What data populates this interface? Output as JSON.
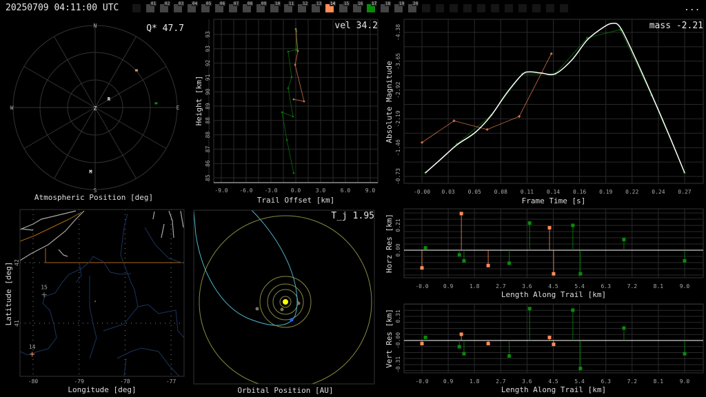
{
  "header": {
    "title": "20250709 04:11:00 UTC",
    "more_label": "..."
  },
  "frames": {
    "leading_empty": 1,
    "labels": [
      "01",
      "02",
      "03",
      "04",
      "05",
      "06",
      "07",
      "08",
      "09",
      "10",
      "11",
      "12",
      "13",
      "14",
      "15",
      "16",
      "17",
      "18",
      "19",
      "20"
    ],
    "trailing_empty": 11,
    "highlighted": {
      "14": "#ff8c5a",
      "17": "#0a8a0a"
    }
  },
  "colors": {
    "station_a": "#ff8c5a",
    "station_b": "#0a8a0a",
    "fit": "#ffffff",
    "grid": "#333333",
    "sun": "#ffff00",
    "orbit_planet": "#8a8a40",
    "orbit_meteor": "#4fb3c8",
    "earth": "#1a6cff"
  },
  "polar": {
    "title": "Atmospheric Position [deg]",
    "stat_label": "Q* 47.7",
    "compass": {
      "n": "N",
      "s": "S",
      "e": "E",
      "w": "W",
      "zenith": "Z"
    },
    "points": [
      {
        "az": 48,
        "zenith": 61,
        "color": "#ff8c5a"
      },
      {
        "az": 86,
        "zenith": 67,
        "color": "#0a8a0a"
      }
    ],
    "markers": [
      {
        "label": "R",
        "az": 57,
        "zenith": 18
      },
      {
        "label": "M",
        "az": 184,
        "zenith": 70
      }
    ]
  },
  "height_plot": {
    "stat_label": "vel 34.2",
    "xlabel": "Trail Offset [km]",
    "ylabel": "Height [km]",
    "xticks": [
      "-9.0",
      "-6.0",
      "-3.0",
      "0.0",
      "3.0",
      "6.0",
      "9.0"
    ],
    "yticks": [
      "85",
      "86",
      "87",
      "88",
      "88",
      "89",
      "90",
      "91",
      "92",
      "93",
      "93"
    ],
    "series": [
      {
        "color": "#0a8a0a",
        "points": [
          [
            0.08,
            93.6
          ],
          [
            0.08,
            92.51
          ],
          [
            -0.92,
            92.39
          ],
          [
            -0.5,
            90.9
          ],
          [
            -0.92,
            90.25
          ],
          [
            -0.33,
            88.59
          ],
          [
            -1.67,
            88.84
          ],
          [
            -1.08,
            87.22
          ],
          [
            -0.25,
            85.28
          ]
        ]
      },
      {
        "color": "#ff8c5a",
        "points": [
          [
            0.0,
            93.72
          ],
          [
            0.25,
            92.43
          ],
          [
            -0.08,
            91.62
          ],
          [
            1.0,
            89.48
          ],
          [
            -0.25,
            89.6
          ]
        ]
      }
    ]
  },
  "magnitude_plot": {
    "stat_label": "mass -2.21",
    "xlabel": "Frame Time [s]",
    "ylabel": "Absolute Magnitude",
    "xticks": [
      "-0.00",
      "0.03",
      "0.05",
      "0.08",
      "0.11",
      "0.14",
      "0.16",
      "0.19",
      "0.22",
      "0.24",
      "0.27"
    ],
    "yticks": [
      "-4.38",
      "-3.65",
      "-2.92",
      "-2.19",
      "-1.46",
      "-0.73"
    ],
    "series": [
      {
        "color": "#0a8a0a",
        "points": [
          [
            0.0035,
            -0.82
          ],
          [
            0.036,
            -1.55
          ],
          [
            0.071,
            -2.28
          ],
          [
            0.103,
            -3.33
          ],
          [
            0.137,
            -3.33
          ],
          [
            0.17,
            -4.24
          ],
          [
            0.204,
            -4.45
          ],
          [
            0.236,
            -2.79
          ],
          [
            0.27,
            -0.82
          ]
        ]
      },
      {
        "color": "#ff8c5a",
        "points": [
          [
            0.0,
            -1.59
          ],
          [
            0.033,
            -2.14
          ],
          [
            0.067,
            -1.92
          ],
          [
            0.1,
            -2.25
          ],
          [
            0.133,
            -3.84
          ]
        ]
      }
    ],
    "fit": [
      [
        0.0035,
        -0.82
      ],
      [
        0.02,
        -1.18
      ],
      [
        0.036,
        -1.53
      ],
      [
        0.055,
        -1.85
      ],
      [
        0.071,
        -2.27
      ],
      [
        0.087,
        -2.84
      ],
      [
        0.103,
        -3.31
      ],
      [
        0.111,
        -3.38
      ],
      [
        0.123,
        -3.35
      ],
      [
        0.137,
        -3.33
      ],
      [
        0.154,
        -3.68
      ],
      [
        0.17,
        -4.19
      ],
      [
        0.186,
        -4.5
      ],
      [
        0.196,
        -4.61
      ],
      [
        0.204,
        -4.5
      ],
      [
        0.218,
        -3.8
      ],
      [
        0.236,
        -2.81
      ],
      [
        0.254,
        -1.78
      ],
      [
        0.27,
        -0.82
      ]
    ]
  },
  "horz_residuals": {
    "xlabel": "Length Along Trail [km]",
    "ylabel": "Horz Res [km]",
    "xticks": [
      "-0.0",
      "0.9",
      "1.8",
      "2.7",
      "3.6",
      "4.5",
      "5.4",
      "6.3",
      "7.2",
      "8.1",
      "9.0"
    ],
    "yticks": [
      "0.00",
      "0.21"
    ],
    "series": [
      {
        "color": "#ff8c5a",
        "points": [
          [
            0,
            -0.15
          ],
          [
            1.35,
            0.31
          ],
          [
            2.27,
            -0.13
          ],
          [
            4.37,
            0.19
          ],
          [
            4.51,
            -0.2
          ]
        ]
      },
      {
        "color": "#0a8a0a",
        "points": [
          [
            0.12,
            0.02
          ],
          [
            1.28,
            -0.04
          ],
          [
            1.44,
            -0.09
          ],
          [
            2.99,
            -0.11
          ],
          [
            3.69,
            0.23
          ],
          [
            5.17,
            0.21
          ],
          [
            5.43,
            -0.2
          ],
          [
            6.92,
            0.09
          ],
          [
            9.0,
            -0.09
          ]
        ]
      }
    ]
  },
  "vert_residuals": {
    "xlabel": "Length Along Trail [km]",
    "ylabel": "Vert Res [km]",
    "xticks": [
      "-0.0",
      "0.9",
      "1.8",
      "2.7",
      "3.6",
      "4.5",
      "5.4",
      "6.3",
      "7.2",
      "8.1",
      "9.0"
    ],
    "yticks": [
      "-0.31",
      "-0.00",
      "0.31"
    ],
    "series": [
      {
        "color": "#ff8c5a",
        "points": [
          [
            0,
            -0.04
          ],
          [
            1.35,
            0.08
          ],
          [
            2.27,
            -0.04
          ],
          [
            4.37,
            0.04
          ],
          [
            4.51,
            -0.05
          ]
        ]
      },
      {
        "color": "#0a8a0a",
        "points": [
          [
            0.12,
            0.04
          ],
          [
            1.28,
            -0.08
          ],
          [
            1.44,
            -0.17
          ],
          [
            2.99,
            -0.2
          ],
          [
            3.69,
            0.41
          ],
          [
            5.17,
            0.39
          ],
          [
            5.43,
            -0.36
          ],
          [
            6.92,
            0.16
          ],
          [
            9.0,
            -0.17
          ]
        ]
      }
    ]
  },
  "map": {
    "xlabel": "Longitude [deg]",
    "ylabel": "Latitude [deg]",
    "xticks": [
      "-80",
      "-79",
      "-78",
      "-77"
    ],
    "yticks": [
      "41",
      "42"
    ],
    "stations": [
      {
        "label": "14",
        "lon": -80.02,
        "lat": 40.49,
        "color": "#ff8c5a"
      },
      {
        "label": "15",
        "lon": -79.76,
        "lat": 41.47,
        "color": "#888888"
      }
    ],
    "meteor": {
      "lon": -78.65,
      "lat": 41.36,
      "color": "#ff8c5a"
    }
  },
  "orbit": {
    "title": "Orbital Position [AU]",
    "stat_label": "T_j 1.95"
  }
}
